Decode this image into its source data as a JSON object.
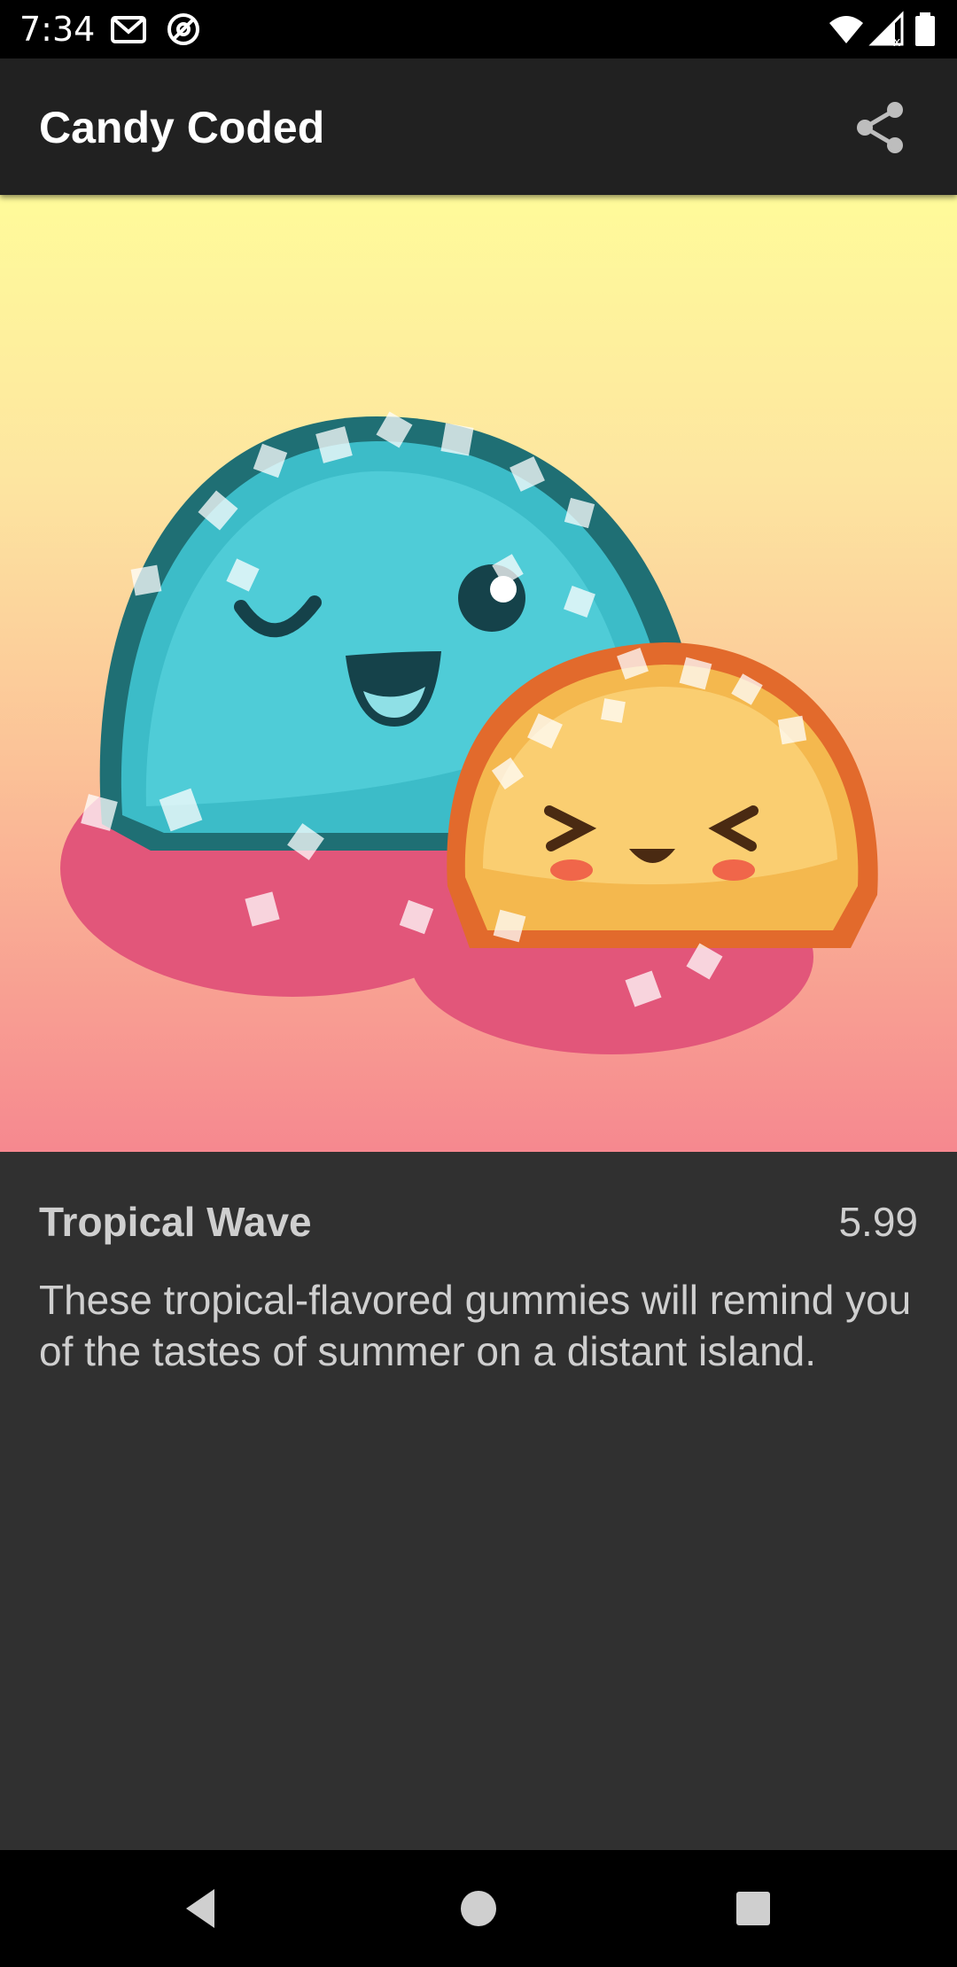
{
  "status_bar": {
    "time": "7:34",
    "icons": [
      "gmail-icon",
      "at-sign-icon",
      "wifi-icon",
      "signal-icon",
      "battery-icon"
    ]
  },
  "app_bar": {
    "title": "Candy Coded",
    "share_icon": "share-icon"
  },
  "candy": {
    "name": "Tropical Wave",
    "price": "5.99",
    "description": "These tropical-flavored gummies will remind you of the tastes of summer on a distant island."
  },
  "colors": {
    "hero_gradient_top": "#fffb9a",
    "hero_gradient_bottom": "#f6888f",
    "app_bar": "#212121",
    "background": "#303030",
    "text": "#cfcfcf"
  },
  "nav_bar": {
    "icons": [
      "back-icon",
      "home-icon",
      "recents-icon"
    ]
  }
}
